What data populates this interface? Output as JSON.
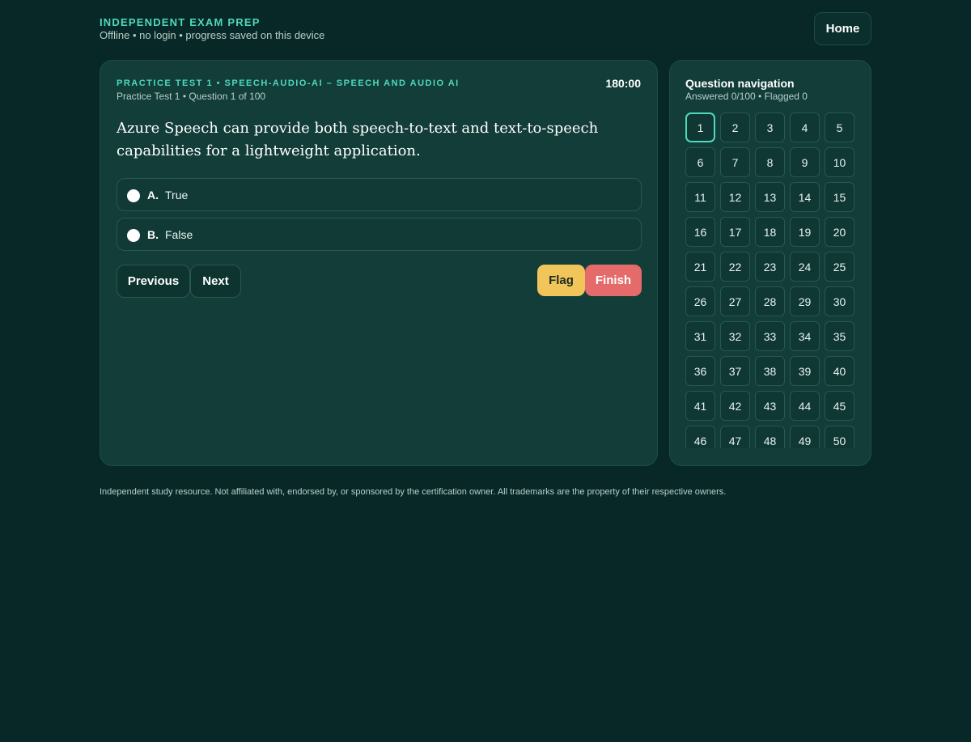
{
  "header": {
    "brand": "INDEPENDENT EXAM PREP",
    "subtitle": "Offline • no login • progress saved on this device",
    "home_label": "Home"
  },
  "exam": {
    "title": "PRACTICE TEST 1 • SPEECH-AUDIO-AI – SPEECH AND AUDIO AI",
    "subtitle": "Practice Test 1 • Question 1 of 100",
    "timer": "180:00",
    "question": "Azure Speech can provide both speech-to-text and text-to-speech capabilities for a lightweight application.",
    "options": [
      {
        "letter": "A.",
        "text": "True"
      },
      {
        "letter": "B.",
        "text": "False"
      }
    ],
    "previous_label": "Previous",
    "next_label": "Next",
    "flag_label": "Flag",
    "finish_label": "Finish"
  },
  "navigation": {
    "title": "Question navigation",
    "status": "Answered 0/100 • Flagged 0",
    "current": 1,
    "question_numbers": [
      "1",
      "2",
      "3",
      "4",
      "5",
      "6",
      "7",
      "8",
      "9",
      "10",
      "11",
      "12",
      "13",
      "14",
      "15",
      "16",
      "17",
      "18",
      "19",
      "20",
      "21",
      "22",
      "23",
      "24",
      "25",
      "26",
      "27",
      "28",
      "29",
      "30",
      "31",
      "32",
      "33",
      "34",
      "35",
      "36",
      "37",
      "38",
      "39",
      "40",
      "41",
      "42",
      "43",
      "44",
      "45",
      "46",
      "47",
      "48",
      "49",
      "50"
    ]
  },
  "footer": {
    "text": "Independent study resource. Not affiliated with, endorsed by, or sponsored by the certification owner. All trademarks are the property of their respective owners."
  },
  "colors": {
    "background": "#072826",
    "card": "#123d39",
    "accent": "#4fd9bd",
    "flag": "#f2c55b",
    "finish": "#e56b6b"
  }
}
